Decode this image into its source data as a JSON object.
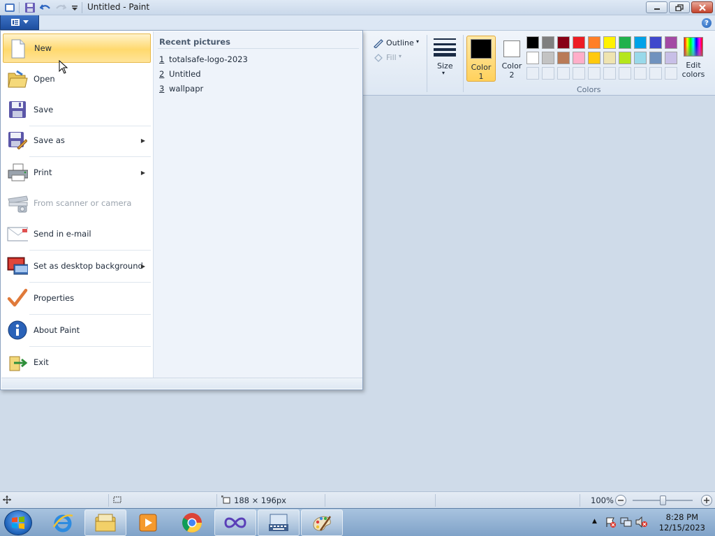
{
  "window": {
    "title": "Untitled - Paint"
  },
  "ribbon": {
    "outline_label": "Outline",
    "fill_label": "Fill",
    "size_label": "Size",
    "color1_label_line1": "Color",
    "color1_label_line2": "1",
    "color2_label_line1": "Color",
    "color2_label_line2": "2",
    "colors_group_label": "Colors",
    "edit_colors_line1": "Edit",
    "edit_colors_line2": "colors",
    "color1_value": "#000000",
    "color2_value": "#ffffff",
    "palette_row1": [
      "#000000",
      "#7f7f7f",
      "#880015",
      "#ed1c24",
      "#ff7f27",
      "#fff200",
      "#22b14c",
      "#00a2e8",
      "#3f48cc",
      "#a349a4"
    ],
    "palette_row2": [
      "#ffffff",
      "#c3c3c3",
      "#b97a57",
      "#ffaec9",
      "#ffc90e",
      "#efe4b0",
      "#b5e61d",
      "#99d9ea",
      "#7092be",
      "#c8bfe7"
    ]
  },
  "file_menu": {
    "items": [
      {
        "label": "New",
        "icon": "new-file-icon",
        "selected": true
      },
      {
        "label": "Open",
        "icon": "open-folder-icon"
      },
      {
        "label": "Save",
        "icon": "save-disk-icon"
      },
      {
        "label": "Save as",
        "icon": "save-as-icon",
        "submenu": true
      },
      {
        "label": "Print",
        "icon": "printer-icon",
        "submenu": true
      },
      {
        "label": "From scanner or camera",
        "icon": "scanner-icon",
        "disabled": true
      },
      {
        "label": "Send in e-mail",
        "icon": "email-icon"
      },
      {
        "label": "Set as desktop background",
        "icon": "desktop-background-icon",
        "submenu": true
      },
      {
        "label": "Properties",
        "icon": "checkmark-icon"
      },
      {
        "label": "About Paint",
        "icon": "info-icon"
      },
      {
        "label": "Exit",
        "icon": "exit-icon"
      }
    ],
    "recent_title": "Recent pictures",
    "recent": [
      {
        "num": "1",
        "name": "totalsafe-logo-2023"
      },
      {
        "num": "2",
        "name": "Untitled"
      },
      {
        "num": "3",
        "name": "wallpapr"
      }
    ]
  },
  "statusbar": {
    "dimensions": "188 × 196px",
    "zoom": "100%",
    "zoom_level": 1.0
  },
  "taskbar": {
    "apps": [
      "internet-explorer-icon",
      "file-explorer-icon",
      "media-player-icon",
      "chrome-icon",
      "infinity-app-icon",
      "on-screen-keyboard-icon",
      "paint-icon"
    ],
    "time": "8:28 PM",
    "date": "12/15/2023"
  }
}
